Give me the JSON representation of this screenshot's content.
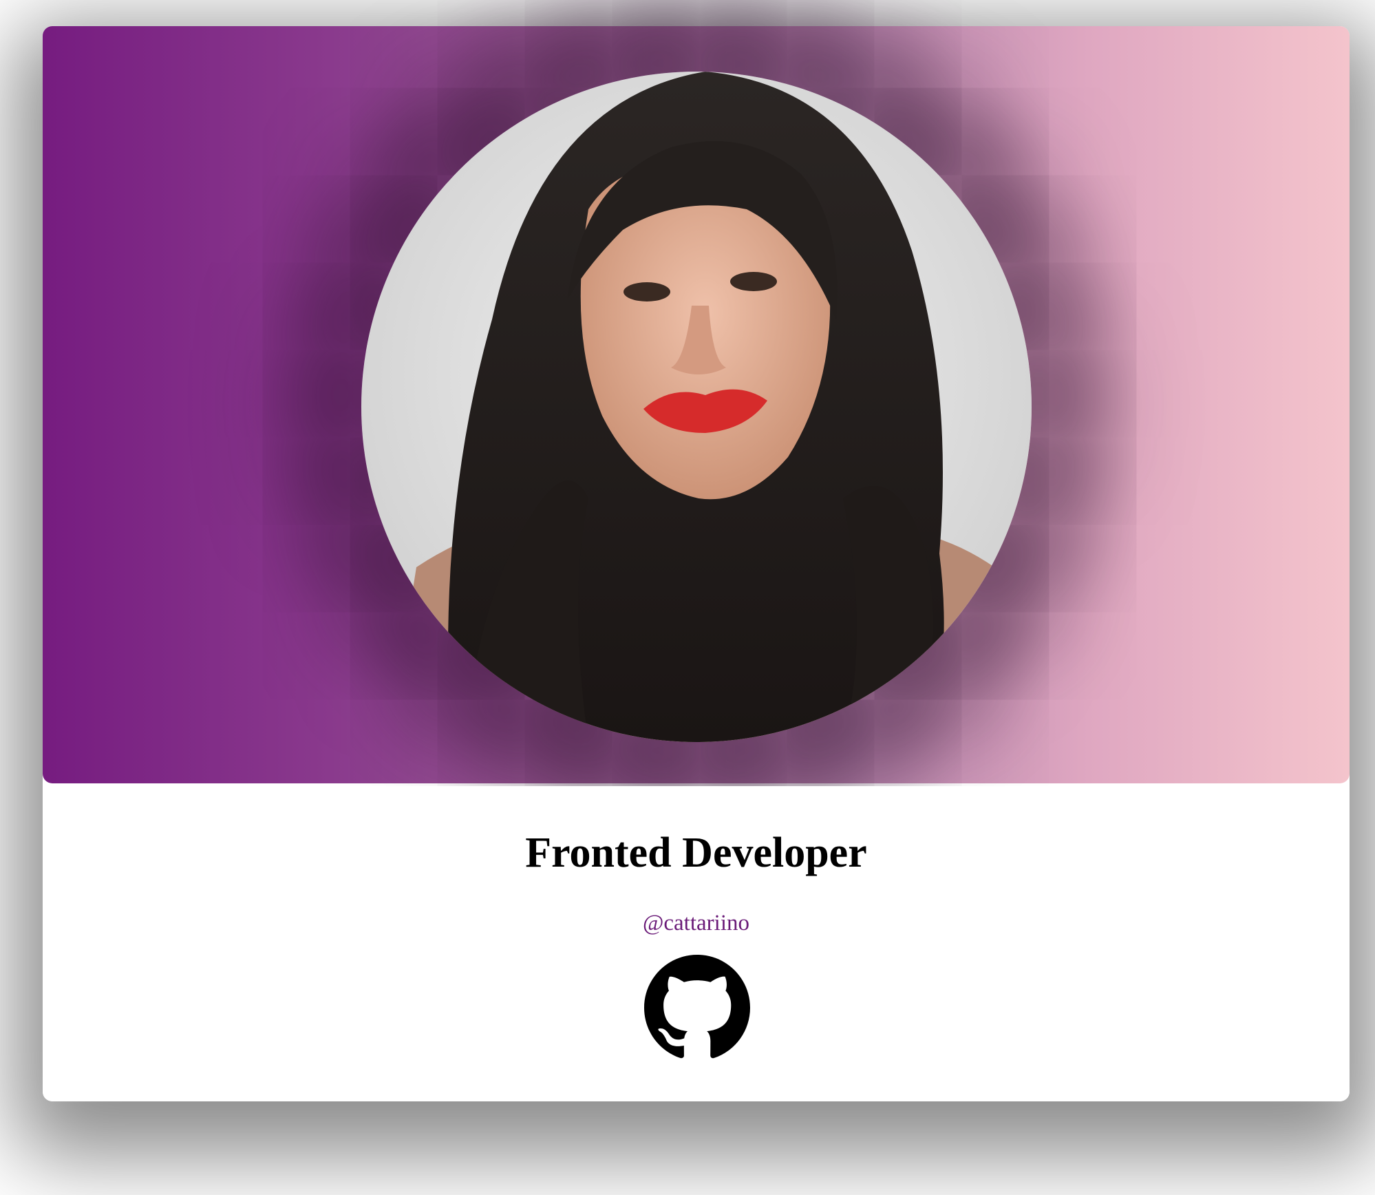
{
  "profile": {
    "title": "Fronted Developer",
    "handle": "@cattariino",
    "avatar_icon": "profile-photo",
    "social_icon": "github-icon"
  },
  "colors": {
    "gradient_start": "#761c80",
    "gradient_end": "#f4c4cc",
    "handle_color": "#6a1b78",
    "title_color": "#000000"
  }
}
